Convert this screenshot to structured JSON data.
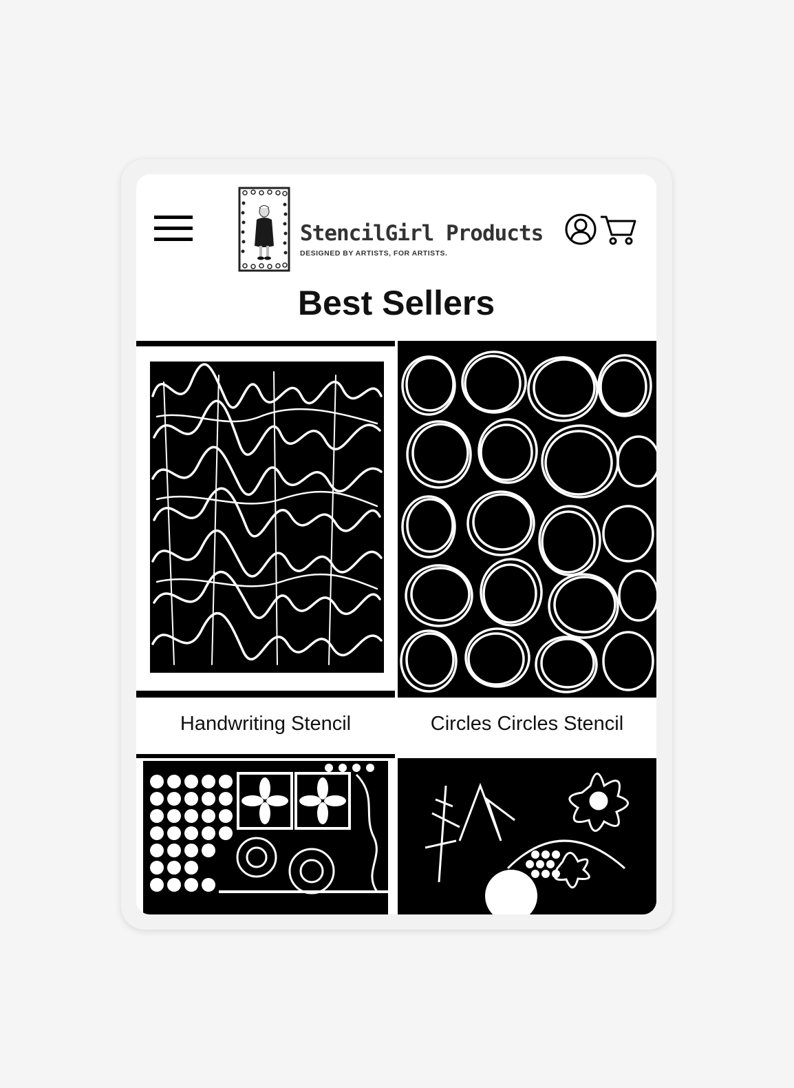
{
  "header": {
    "brand_name": "StencilGirl Products",
    "brand_tagline": "DESIGNED BY ARTISTS, FOR ARTISTS.",
    "icons": [
      "menu-icon",
      "account-icon",
      "cart-icon"
    ]
  },
  "section": {
    "title": "Best Sellers"
  },
  "products": [
    {
      "name": "Handwriting Stencil"
    },
    {
      "name": "Circles Circles Stencil"
    },
    {
      "name": ""
    },
    {
      "name": ""
    }
  ],
  "colors": {
    "page_bg": "#f5f5f5",
    "device_frame": "#f2f2f2",
    "screen_bg": "#ffffff",
    "text": "#111111",
    "stencil_black": "#000000"
  }
}
